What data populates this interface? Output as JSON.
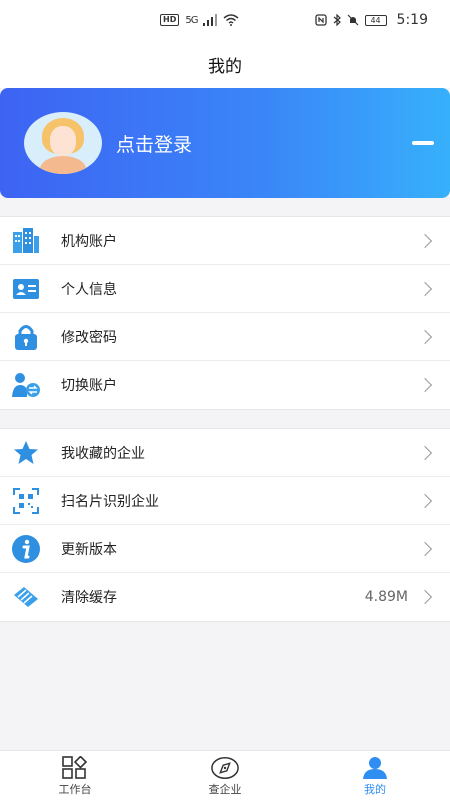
{
  "status_bar": {
    "hd": "HD",
    "net": "5G",
    "battery": "44",
    "time": "5:19"
  },
  "header": {
    "title": "我的"
  },
  "profile": {
    "login_label": "点击登录"
  },
  "menu_group_1": [
    {
      "label": "机构账户",
      "icon": "building-icon"
    },
    {
      "label": "个人信息",
      "icon": "id-card-icon"
    },
    {
      "label": "修改密码",
      "icon": "lock-icon"
    },
    {
      "label": "切换账户",
      "icon": "switch-user-icon"
    }
  ],
  "menu_group_2": [
    {
      "label": "我收藏的企业",
      "icon": "star-icon"
    },
    {
      "label": "扫名片识别企业",
      "icon": "scan-icon"
    },
    {
      "label": "更新版本",
      "icon": "info-icon"
    },
    {
      "label": "清除缓存",
      "icon": "broom-icon",
      "value": "4.89M"
    }
  ],
  "bottom_nav": [
    {
      "label": "工作台",
      "icon": "grid-icon",
      "active": false
    },
    {
      "label": "查企业",
      "icon": "compass-icon",
      "active": false
    },
    {
      "label": "我的",
      "icon": "user-icon",
      "active": true
    }
  ],
  "colors": {
    "accent": "#2e8ef2",
    "gradient_start": "#3d63f3",
    "gradient_end": "#37b0fb"
  }
}
